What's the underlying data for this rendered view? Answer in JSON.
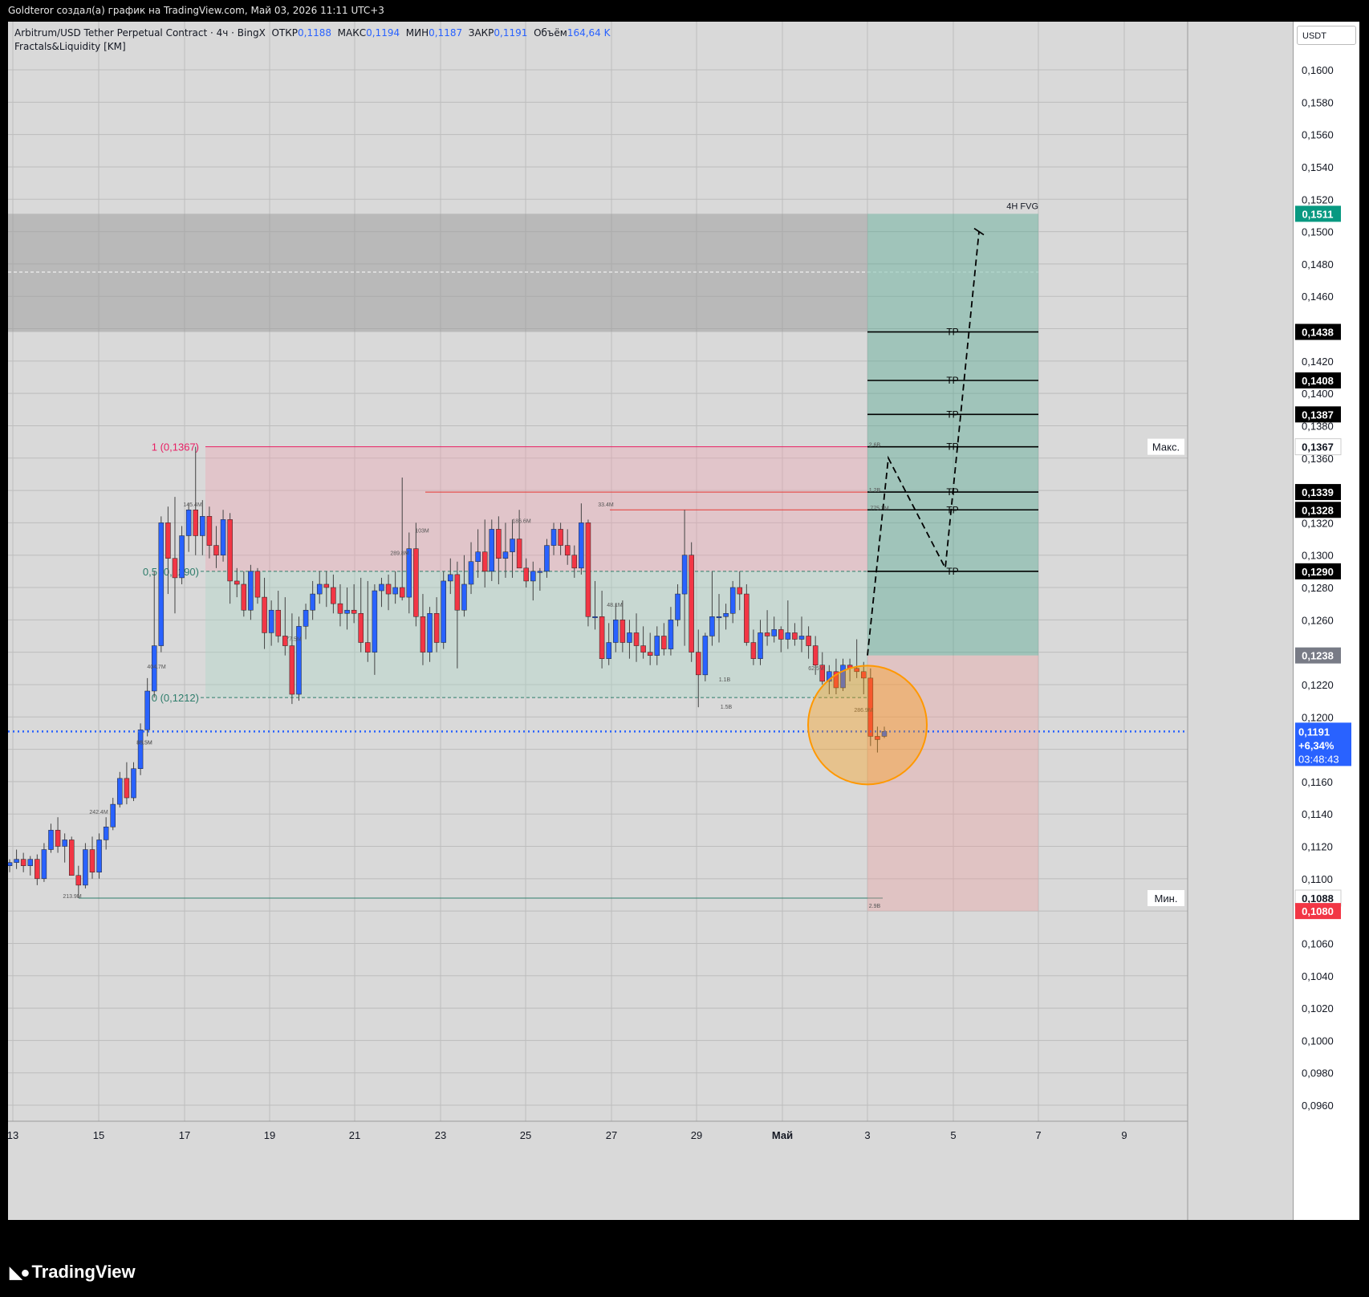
{
  "caption": "Goldteror создал(а) график на TradingView.com, Май 03, 2026 11:11 UTC+3",
  "header": {
    "symbol": "Arbitrum/USD Tether Perpetual Contract · 4ч · BingX",
    "open_label": "ОТКР",
    "open": "0,1188",
    "high_label": "МАКС",
    "high": "0,1194",
    "low_label": "МИН",
    "low": "0,1187",
    "close_label": "ЗАКР",
    "close": "0,1191",
    "volume_label": "Объём",
    "volume": "164,64 K"
  },
  "indicator": "Fractals&Liquidity [KM]",
  "currency_button": "USDT",
  "brand": "TradingView",
  "zone_label": "4H FVG",
  "chart_data": {
    "type": "candlestick",
    "ylim": [
      0.095,
      0.1625
    ],
    "y_ticks": [
      "0,1600",
      "0,1580",
      "0,1560",
      "0,1540",
      "0,1520",
      "0,1500",
      "0,1480",
      "0,1460",
      "0,1440",
      "0,1420",
      "0,1400",
      "0,1380",
      "0,1360",
      "0,1340",
      "0,1320",
      "0,1300",
      "0,1280",
      "0,1260",
      "0,1240",
      "0,1220",
      "0,1200",
      "0,1180",
      "0,1160",
      "0,1140",
      "0,1120",
      "0,1100",
      "0,1080",
      "0,1060",
      "0,1040",
      "0,1020",
      "0,1000",
      "0,0980",
      "0,0960"
    ],
    "x_ticks": [
      "13",
      "15",
      "17",
      "19",
      "21",
      "23",
      "25",
      "27",
      "29",
      "Май",
      "3",
      "5",
      "7",
      "9"
    ],
    "fib_labels": [
      {
        "text": "1 (0,1367)",
        "value": 0.1367
      },
      {
        "text": "0,5 (0,1290)",
        "value": 0.129
      },
      {
        "text": "0 (0,1212)",
        "value": 0.1212
      }
    ],
    "tp_levels": [
      0.1438,
      0.1408,
      0.1387,
      0.1367,
      0.1339,
      0.1328,
      0.129
    ],
    "tp_label": "TP",
    "price_tags": [
      {
        "text": "0,1511",
        "color": "#089981"
      },
      {
        "text": "0,1438",
        "color": "#000000"
      },
      {
        "text": "0,1408",
        "color": "#000000"
      },
      {
        "text": "0,1387",
        "color": "#000000"
      },
      {
        "text": "0,1367",
        "color": "#000000"
      },
      {
        "text": "0,1367",
        "color": "#ffffff",
        "side_label": "Макс."
      },
      {
        "text": "0,1339",
        "color": "#000000"
      },
      {
        "text": "0,1328",
        "color": "#000000"
      },
      {
        "text": "0,1290",
        "color": "#000000"
      },
      {
        "text": "0,1238",
        "color": "#787b86"
      },
      {
        "text": "0,1088",
        "color": "#ffffff",
        "side_label": "Мин."
      },
      {
        "text": "0,1080",
        "color": "#f23645"
      }
    ],
    "current_price": {
      "price": "0,1191",
      "change": "+6,34%",
      "countdown": "03:48:43",
      "value": 0.1191
    },
    "volume_labels": [
      "145.4M",
      "186.6M",
      "33.4M",
      "289.8M",
      "103M",
      "48.1M",
      "404.7M",
      "77.5M",
      "1.1B",
      "1.5B",
      "62.5M",
      "286.9M",
      "85.5M",
      "242.4M",
      "88.5M",
      "213.9M",
      "2.6B",
      "1.2B",
      "775.3M",
      "2.9B"
    ],
    "candles": [
      [
        0.1108,
        0.1112,
        0.1104,
        0.111
      ],
      [
        0.111,
        0.1118,
        0.1106,
        0.1112
      ],
      [
        0.1112,
        0.1116,
        0.1104,
        0.1108
      ],
      [
        0.1108,
        0.1114,
        0.1102,
        0.1112
      ],
      [
        0.1112,
        0.1115,
        0.1096,
        0.11
      ],
      [
        0.11,
        0.1122,
        0.1098,
        0.1118
      ],
      [
        0.1118,
        0.1134,
        0.1116,
        0.113
      ],
      [
        0.113,
        0.1138,
        0.1116,
        0.112
      ],
      [
        0.112,
        0.1128,
        0.111,
        0.1124
      ],
      [
        0.1124,
        0.1126,
        0.1106,
        0.1102
      ],
      [
        0.1102,
        0.1108,
        0.1088,
        0.1096
      ],
      [
        0.1096,
        0.1122,
        0.1094,
        0.1118
      ],
      [
        0.1118,
        0.1126,
        0.11,
        0.1104
      ],
      [
        0.1104,
        0.1128,
        0.11,
        0.1124
      ],
      [
        0.1124,
        0.1138,
        0.1118,
        0.1132
      ],
      [
        0.1132,
        0.115,
        0.113,
        0.1146
      ],
      [
        0.1146,
        0.1166,
        0.1144,
        0.1162
      ],
      [
        0.1162,
        0.1172,
        0.1146,
        0.115
      ],
      [
        0.115,
        0.1172,
        0.1148,
        0.1168
      ],
      [
        0.1168,
        0.1196,
        0.1164,
        0.1192
      ],
      [
        0.1192,
        0.1224,
        0.1188,
        0.1216
      ],
      [
        0.1216,
        0.129,
        0.1212,
        0.1244
      ],
      [
        0.1244,
        0.1324,
        0.124,
        0.132
      ],
      [
        0.132,
        0.133,
        0.1276,
        0.1298
      ],
      [
        0.1298,
        0.1336,
        0.1264,
        0.1286
      ],
      [
        0.1286,
        0.1318,
        0.1282,
        0.1312
      ],
      [
        0.1312,
        0.1332,
        0.1302,
        0.1328
      ],
      [
        0.1328,
        0.1367,
        0.13,
        0.1312
      ],
      [
        0.1312,
        0.1334,
        0.13,
        0.1324
      ],
      [
        0.1324,
        0.133,
        0.1298,
        0.1306
      ],
      [
        0.1306,
        0.1318,
        0.1292,
        0.13
      ],
      [
        0.13,
        0.1328,
        0.1296,
        0.1322
      ],
      [
        0.1322,
        0.1326,
        0.127,
        0.1284
      ],
      [
        0.1284,
        0.1292,
        0.1274,
        0.1282
      ],
      [
        0.1282,
        0.129,
        0.1262,
        0.1266
      ],
      [
        0.1266,
        0.1294,
        0.126,
        0.129
      ],
      [
        0.129,
        0.1292,
        0.127,
        0.1274
      ],
      [
        0.1274,
        0.1286,
        0.1242,
        0.1252
      ],
      [
        0.1252,
        0.1272,
        0.1244,
        0.1266
      ],
      [
        0.1266,
        0.1278,
        0.1246,
        0.125
      ],
      [
        0.125,
        0.1274,
        0.1238,
        0.1244
      ],
      [
        0.1244,
        0.1264,
        0.1208,
        0.1214
      ],
      [
        0.1214,
        0.1262,
        0.121,
        0.1256
      ],
      [
        0.1256,
        0.127,
        0.1248,
        0.1266
      ],
      [
        0.1266,
        0.1284,
        0.126,
        0.1276
      ],
      [
        0.1276,
        0.129,
        0.127,
        0.1282
      ],
      [
        0.1282,
        0.129,
        0.1268,
        0.128
      ],
      [
        0.128,
        0.1288,
        0.1264,
        0.127
      ],
      [
        0.127,
        0.1282,
        0.1256,
        0.1264
      ],
      [
        0.1264,
        0.128,
        0.1254,
        0.1266
      ],
      [
        0.1266,
        0.1282,
        0.1258,
        0.1264
      ],
      [
        0.1264,
        0.1286,
        0.124,
        0.1246
      ],
      [
        0.1246,
        0.1284,
        0.1234,
        0.124
      ],
      [
        0.124,
        0.1282,
        0.1226,
        0.1278
      ],
      [
        0.1278,
        0.1286,
        0.1268,
        0.1282
      ],
      [
        0.1282,
        0.1288,
        0.1266,
        0.1276
      ],
      [
        0.1276,
        0.129,
        0.127,
        0.128
      ],
      [
        0.128,
        0.1348,
        0.1272,
        0.1274
      ],
      [
        0.1274,
        0.1314,
        0.1264,
        0.1304
      ],
      [
        0.1304,
        0.132,
        0.1256,
        0.1262
      ],
      [
        0.1262,
        0.1276,
        0.1232,
        0.124
      ],
      [
        0.124,
        0.1268,
        0.1234,
        0.1264
      ],
      [
        0.1264,
        0.1274,
        0.124,
        0.1246
      ],
      [
        0.1246,
        0.129,
        0.1242,
        0.1284
      ],
      [
        0.1284,
        0.1298,
        0.1276,
        0.1288
      ],
      [
        0.1288,
        0.1296,
        0.123,
        0.1266
      ],
      [
        0.1266,
        0.13,
        0.1262,
        0.1282
      ],
      [
        0.1282,
        0.1308,
        0.1276,
        0.1296
      ],
      [
        0.1296,
        0.1316,
        0.1286,
        0.1302
      ],
      [
        0.1302,
        0.1322,
        0.128,
        0.129
      ],
      [
        0.129,
        0.1322,
        0.1284,
        0.1316
      ],
      [
        0.1316,
        0.1324,
        0.1282,
        0.1298
      ],
      [
        0.1298,
        0.132,
        0.1286,
        0.1302
      ],
      [
        0.1302,
        0.1322,
        0.1286,
        0.131
      ],
      [
        0.131,
        0.1328,
        0.1294,
        0.1292
      ],
      [
        0.1292,
        0.1298,
        0.128,
        0.1284
      ],
      [
        0.1284,
        0.1296,
        0.1272,
        0.129
      ],
      [
        0.129,
        0.1292,
        0.1278,
        0.129
      ],
      [
        0.129,
        0.131,
        0.1286,
        0.1306
      ],
      [
        0.1306,
        0.132,
        0.13,
        0.1316
      ],
      [
        0.1316,
        0.132,
        0.13,
        0.1306
      ],
      [
        0.1306,
        0.1316,
        0.1294,
        0.13
      ],
      [
        0.13,
        0.1306,
        0.1286,
        0.1292
      ],
      [
        0.1292,
        0.1332,
        0.1288,
        0.132
      ],
      [
        0.132,
        0.1322,
        0.1256,
        0.1262
      ],
      [
        0.1262,
        0.1284,
        0.1254,
        0.1262
      ],
      [
        0.1262,
        0.1278,
        0.123,
        0.1236
      ],
      [
        0.1236,
        0.1258,
        0.1232,
        0.1246
      ],
      [
        0.1246,
        0.127,
        0.124,
        0.126
      ],
      [
        0.126,
        0.1272,
        0.124,
        0.1246
      ],
      [
        0.1246,
        0.126,
        0.1236,
        0.1252
      ],
      [
        0.1252,
        0.1264,
        0.1234,
        0.1244
      ],
      [
        0.1244,
        0.1256,
        0.1236,
        0.124
      ],
      [
        0.124,
        0.1252,
        0.1232,
        0.1238
      ],
      [
        0.1238,
        0.1256,
        0.1232,
        0.125
      ],
      [
        0.125,
        0.1258,
        0.1238,
        0.1242
      ],
      [
        0.1242,
        0.1268,
        0.1238,
        0.126
      ],
      [
        0.126,
        0.1282,
        0.1256,
        0.1276
      ],
      [
        0.1276,
        0.1328,
        0.1244,
        0.13
      ],
      [
        0.13,
        0.1308,
        0.1234,
        0.124
      ],
      [
        0.124,
        0.1254,
        0.1206,
        0.1226
      ],
      [
        0.1226,
        0.1252,
        0.1222,
        0.125
      ],
      [
        0.125,
        0.129,
        0.1244,
        0.1262
      ],
      [
        0.1262,
        0.1276,
        0.1246,
        0.1262
      ],
      [
        0.1262,
        0.127,
        0.1254,
        0.1264
      ],
      [
        0.1264,
        0.1284,
        0.1258,
        0.128
      ],
      [
        0.128,
        0.129,
        0.1266,
        0.1276
      ],
      [
        0.1276,
        0.1282,
        0.1244,
        0.1246
      ],
      [
        0.1246,
        0.1254,
        0.1232,
        0.1236
      ],
      [
        0.1236,
        0.126,
        0.1232,
        0.1252
      ],
      [
        0.1252,
        0.1266,
        0.1244,
        0.125
      ],
      [
        0.125,
        0.1262,
        0.1246,
        0.1254
      ],
      [
        0.1254,
        0.1256,
        0.124,
        0.1248
      ],
      [
        0.1248,
        0.1272,
        0.1242,
        0.1252
      ],
      [
        0.1252,
        0.1258,
        0.1244,
        0.1248
      ],
      [
        0.1248,
        0.1262,
        0.124,
        0.125
      ],
      [
        0.125,
        0.1256,
        0.1236,
        0.1244
      ],
      [
        0.1244,
        0.125,
        0.1226,
        0.1232
      ],
      [
        0.1232,
        0.124,
        0.122,
        0.1222
      ],
      [
        0.1222,
        0.1232,
        0.1214,
        0.1228
      ],
      [
        0.1228,
        0.1236,
        0.1214,
        0.1218
      ],
      [
        0.1218,
        0.1236,
        0.1216,
        0.1232
      ],
      [
        0.1232,
        0.1236,
        0.1222,
        0.123
      ],
      [
        0.123,
        0.1248,
        0.1224,
        0.1228
      ],
      [
        0.1228,
        0.1234,
        0.1214,
        0.1224
      ],
      [
        0.1224,
        0.123,
        0.1182,
        0.1188
      ],
      [
        0.1188,
        0.1194,
        0.1178,
        0.1186
      ],
      [
        0.1188,
        0.1194,
        0.1187,
        0.1191
      ]
    ],
    "projection_path": [
      [
        0.1238
      ],
      [
        0.136
      ],
      [
        0.1292
      ],
      [
        0.15
      ]
    ]
  }
}
